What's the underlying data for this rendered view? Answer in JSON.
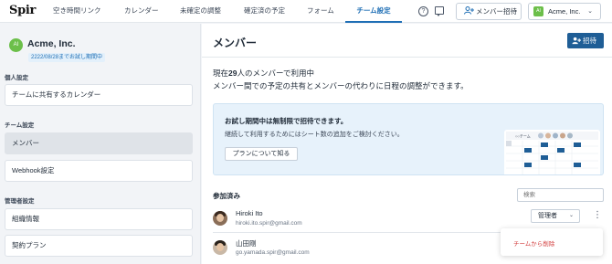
{
  "app": {
    "logo": "Spir"
  },
  "nav": {
    "tabs": [
      {
        "label": "空き時間リンク",
        "active": false
      },
      {
        "label": "カレンダー",
        "active": false
      },
      {
        "label": "未確定の調整",
        "active": false
      },
      {
        "label": "確定済の予定",
        "active": false
      },
      {
        "label": "フォーム",
        "active": false
      },
      {
        "label": "チーム設定",
        "active": true
      }
    ],
    "help_icon": "question-circle-icon",
    "chat_icon": "chat-icon",
    "invite_label": "メンバー招待",
    "invite_icon": "person-add-icon",
    "workspace": {
      "initials": "AI",
      "name": "Acme, Inc.",
      "color": "#6cbf4a"
    }
  },
  "sidebar": {
    "org_initials": "AI",
    "org_name": "Acme, Inc.",
    "trial_badge": "2222/08/28までお試し期間中",
    "sections": [
      {
        "label": "個人設定",
        "items": [
          {
            "label": "チームに共有するカレンダー",
            "selected": false
          }
        ]
      },
      {
        "label": "チーム設定",
        "items": [
          {
            "label": "メンバー",
            "selected": true
          },
          {
            "label": "Webhook設定",
            "selected": false
          }
        ]
      },
      {
        "label": "管理者設定",
        "items": [
          {
            "label": "組織情報",
            "selected": false
          },
          {
            "label": "契約プラン",
            "selected": false
          }
        ]
      }
    ]
  },
  "main": {
    "title": "メンバー",
    "invite_button": "招待",
    "desc_pre": "現在",
    "desc_count": "29",
    "desc_post": "人のメンバーで利用中",
    "desc_line2": "メンバー間での予定の共有とメンバーの代わりに日程の調整ができます。",
    "promo": {
      "title": "お試し期間中は無制限で招待できます。",
      "text": "継続して利用するためにはシート数の追加をご検討ください。",
      "button": "プランについて知る",
      "illus_label": "○○チーム"
    },
    "members_heading": "参加済み",
    "search_placeholder": "検索",
    "members": [
      {
        "name": "Hiroki Ito",
        "email": "hiroki.ito.spir@gmail.com",
        "role": "管理者"
      },
      {
        "name": "山田剛",
        "email": "go.yamada.spir@gmail.com"
      }
    ],
    "context_menu": {
      "item": "チームから削除"
    }
  }
}
